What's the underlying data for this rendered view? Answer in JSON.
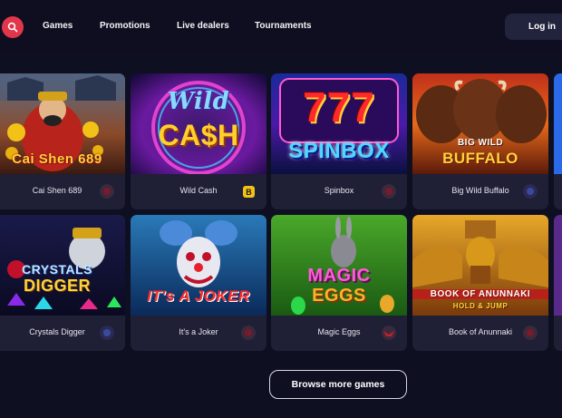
{
  "nav": {
    "search_icon": "search-icon",
    "links": [
      "Games",
      "Promotions",
      "Live dealers",
      "Tournaments"
    ],
    "login_label": "Log in"
  },
  "games": [
    {
      "name": "Cai Shen 689",
      "art_title": "Cai Shen 689",
      "provider_badge": "red-circle"
    },
    {
      "name": "Wild Cash",
      "art_title_1": "Wild",
      "art_title_2": "CA$H",
      "provider_badge": "B"
    },
    {
      "name": "Spinbox",
      "art_title_1": "777",
      "art_title_2": "SPINBOX",
      "provider_badge": "red-circle"
    },
    {
      "name": "Big Wild Buffalo",
      "art_title_1": "BIG WILD",
      "art_title_2": "BUFFALO",
      "provider_badge": "blue-circle"
    },
    {
      "name": "Crystals Digger",
      "art_title_1": "CRYSTALS",
      "art_title_2": "DIGGER",
      "provider_badge": "blue-circle"
    },
    {
      "name": "It's a Joker",
      "art_title": "IT's A JOKER",
      "provider_badge": "red-circle"
    },
    {
      "name": "Magic Eggs",
      "art_title_1": "MAGIC",
      "art_title_2": "EGGS",
      "provider_badge": "red-wings"
    },
    {
      "name": "Book of Anunnaki",
      "art_title_1": "BOOK OF ANUNNAKI",
      "art_title_2": "HOLD & JUMP",
      "provider_badge": "red-circle"
    }
  ],
  "browse_label": "Browse more games",
  "colors": {
    "background": "#0f0f22",
    "card": "#1f1f35",
    "accent_red": "#e2364b",
    "badge_yellow": "#f2c316"
  }
}
